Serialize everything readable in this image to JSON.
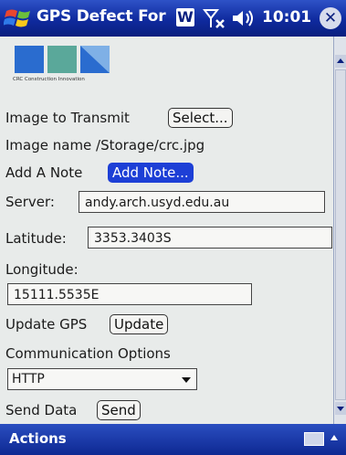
{
  "titlebar": {
    "title": "GPS Defect For",
    "word_icon": "W",
    "clock": "10:01",
    "close_glyph": "✕"
  },
  "logo": {
    "caption": "CRC Construction Innovation"
  },
  "form": {
    "image_to_transmit_label": "Image to Transmit",
    "select_button": "Select...",
    "image_name_label": "Image name /Storage/crc.jpg",
    "add_note_label": "Add A Note",
    "add_note_button": "Add Note...",
    "server_label": "Server:",
    "server_value": "andy.arch.usyd.edu.au",
    "latitude_label": "Latitude:",
    "latitude_value": "3353.3403S",
    "longitude_label": "Longitude:",
    "longitude_value": "15111.5535E",
    "update_gps_label": "Update GPS",
    "update_button": "Update",
    "communication_label": "Communication Options",
    "protocol_selected": "HTTP",
    "send_data_label": "Send Data",
    "send_button": "Send"
  },
  "menubar": {
    "actions_label": "Actions"
  },
  "colors": {
    "titlebar": "#0f2a9e",
    "accent_button": "#1d3fd6",
    "logo_blue": "#2a6ccf",
    "logo_green": "#5aa89a"
  }
}
